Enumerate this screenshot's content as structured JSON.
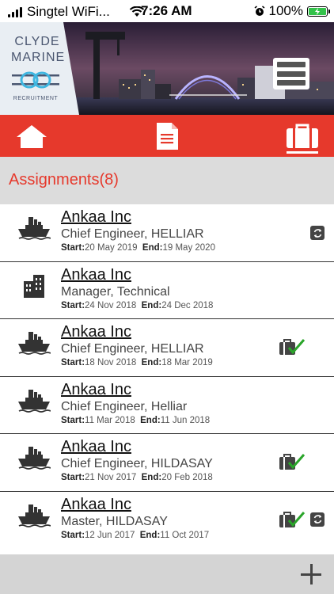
{
  "status_bar": {
    "carrier": "Singtel WiFi...",
    "time": "7:26 AM",
    "battery": "100%"
  },
  "brand": {
    "line1": "CLYDE",
    "line2": "MARINE",
    "tagline": "RECRUITMENT"
  },
  "tabs": [
    {
      "name": "home-icon",
      "active": false
    },
    {
      "name": "document-icon",
      "active": false
    },
    {
      "name": "briefcase-icon",
      "active": true
    }
  ],
  "section": {
    "title": "Assignments(8)"
  },
  "labels": {
    "start": "Start:",
    "end": "End:"
  },
  "assignments": [
    {
      "company": "Ankaa Inc",
      "role": "Chief Engineer, HELLIAR",
      "start": "20 May 2019",
      "end": "19 May 2020",
      "icon": "ship-icon",
      "status_icons": [
        "sync-icon"
      ]
    },
    {
      "company": "Ankaa Inc",
      "role": "Manager, Technical",
      "start": "24 Nov 2018",
      "end": "24 Dec 2018",
      "icon": "building-icon",
      "status_icons": []
    },
    {
      "company": "Ankaa Inc",
      "role": "Chief Engineer, HELLIAR",
      "start": "18 Nov 2018",
      "end": "18 Mar 2019",
      "icon": "ship-icon",
      "status_icons": [
        "briefcase-check-icon"
      ]
    },
    {
      "company": "Ankaa Inc",
      "role": "Chief Engineer, Helliar",
      "start": "11 Mar 2018",
      "end": "11 Jun 2018",
      "icon": "ship-icon",
      "status_icons": []
    },
    {
      "company": "Ankaa Inc",
      "role": "Chief Engineer, HILDASAY",
      "start": "21 Nov 2017",
      "end": "20 Feb 2018",
      "icon": "ship-icon",
      "status_icons": [
        "briefcase-check-icon"
      ]
    },
    {
      "company": "Ankaa Inc",
      "role": "Master, HILDASAY",
      "start": "12 Jun 2017",
      "end": "11 Oct 2017",
      "icon": "ship-icon",
      "status_icons": [
        "briefcase-check-icon",
        "sync-icon"
      ]
    }
  ],
  "colors": {
    "accent": "#e6392c",
    "check": "#2aa52a"
  }
}
